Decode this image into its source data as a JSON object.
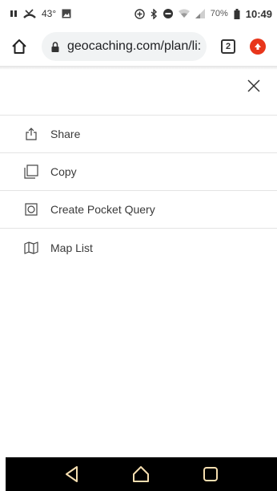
{
  "status_bar": {
    "temperature": "43°",
    "battery_percent": "70%",
    "time": "10:49",
    "icons": [
      "pause-icon",
      "missed-call-icon",
      "image-icon",
      "data-saver-icon",
      "bluetooth-icon",
      "do-not-disturb-icon",
      "wifi-icon",
      "signal-icon",
      "battery-icon"
    ]
  },
  "browser": {
    "url": "geocaching.com/plan/li:",
    "tab_count": "2"
  },
  "menu": {
    "items": [
      {
        "label": "Share",
        "icon": "share-icon"
      },
      {
        "label": "Copy",
        "icon": "copy-icon"
      },
      {
        "label": "Create Pocket Query",
        "icon": "pocket-query-icon"
      },
      {
        "label": "Map List",
        "icon": "map-icon"
      }
    ]
  },
  "colors": {
    "update_badge": "#e8361b",
    "nav_bar": "#000000",
    "nav_icon": "#f5deb0"
  }
}
